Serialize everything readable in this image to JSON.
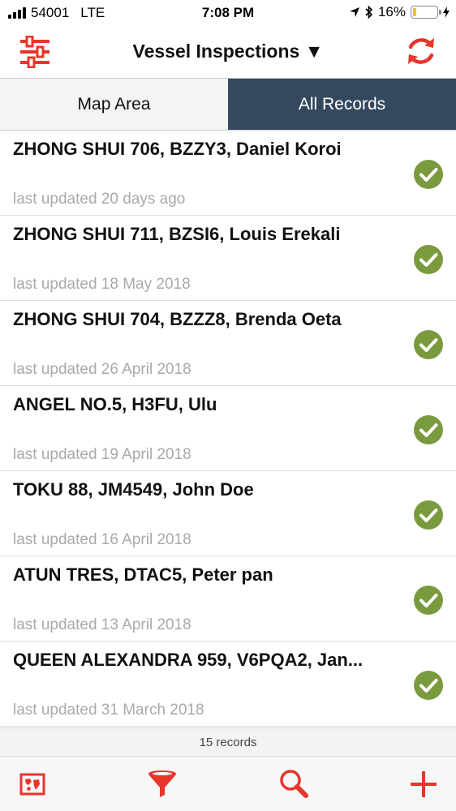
{
  "status_bar": {
    "carrier": "54001",
    "network": "LTE",
    "time": "7:08 PM",
    "battery_text": "16%",
    "battery_level": 0.16
  },
  "nav": {
    "title": "Vessel Inspections ▼",
    "filter_settings_icon": "sliders-icon",
    "refresh_icon": "refresh-icon"
  },
  "tabs": [
    {
      "label": "Map Area",
      "active": false
    },
    {
      "label": "All Records",
      "active": true
    }
  ],
  "records": [
    {
      "title": "ZHONG SHUI 706, BZZY3, Daniel Koroi",
      "updated": "last updated 20 days ago",
      "status": "completed"
    },
    {
      "title": "ZHONG SHUI 711, BZSI6, Louis Erekali",
      "updated": "last updated 18 May 2018",
      "status": "completed"
    },
    {
      "title": "ZHONG SHUI 704, BZZZ8, Brenda Oeta",
      "updated": "last updated 26 April 2018",
      "status": "completed"
    },
    {
      "title": "ANGEL NO.5, H3FU, Ulu",
      "updated": "last updated 19 April 2018",
      "status": "completed"
    },
    {
      "title": "TOKU 88, JM4549, John Doe",
      "updated": "last updated 16 April 2018",
      "status": "completed"
    },
    {
      "title": "ATUN TRES, DTAC5, Peter pan",
      "updated": "last updated 13 April 2018",
      "status": "completed"
    },
    {
      "title": "QUEEN ALEXANDRA 959, V6PQA2, Jan...",
      "updated": "last updated 31 March 2018",
      "status": "completed"
    }
  ],
  "record_count": "15 records",
  "toolbar": {
    "map_icon": "map-icon",
    "filter_icon": "funnel-icon",
    "search_icon": "search-icon",
    "add_icon": "plus-icon"
  },
  "colors": {
    "accent_red": "#e8352b",
    "active_tab": "#34495e",
    "check_green": "#7a9a3e"
  }
}
